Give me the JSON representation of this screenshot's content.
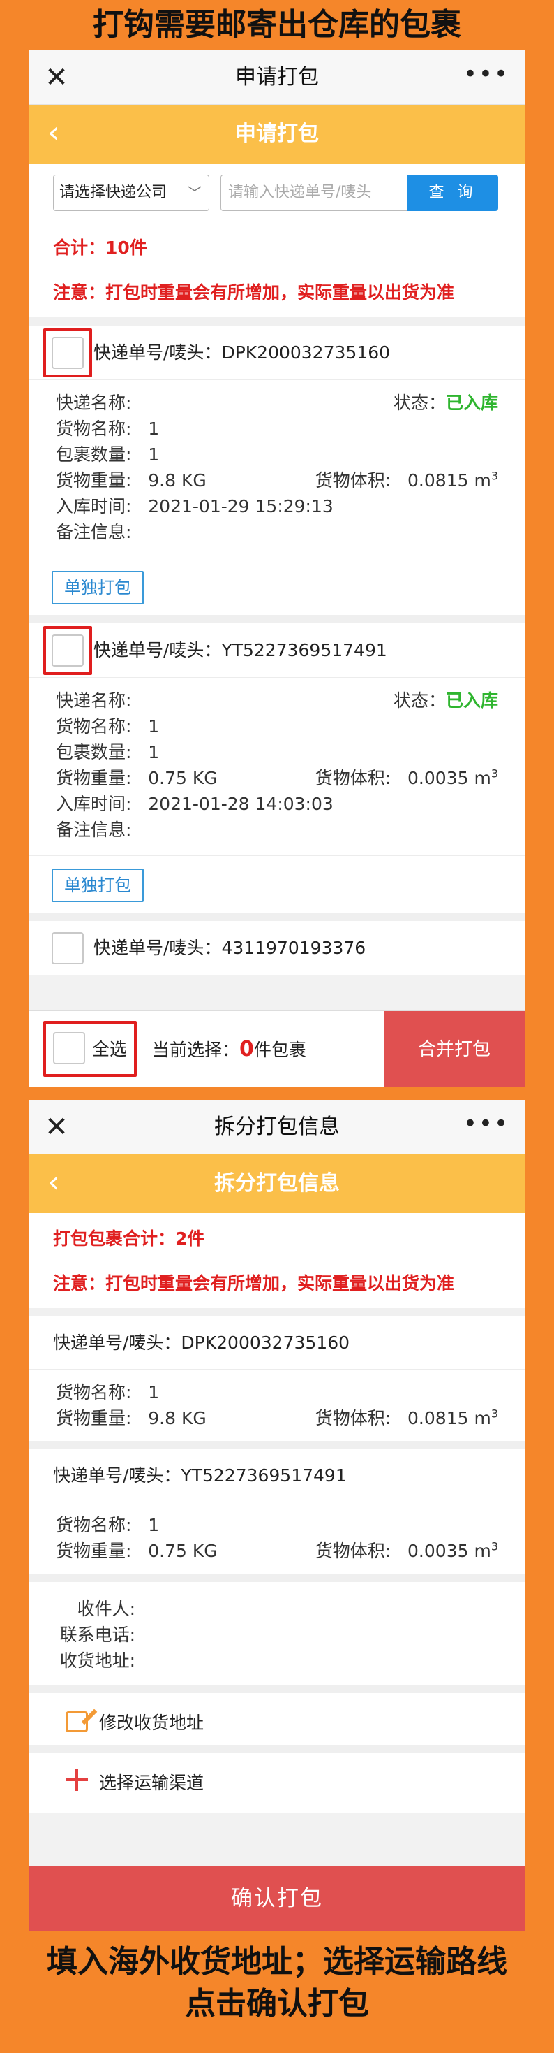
{
  "captions": {
    "top": "打钩需要邮寄出仓库的包裹",
    "bottom_line1": "填入海外收货地址；选择运输路线",
    "bottom_line2": "点击确认打包"
  },
  "screen1": {
    "wx_title": "申请打包",
    "header_title": "申请打包",
    "courier_select": "请选择快递公司",
    "tracking_placeholder": "请输入快递单号/唛头",
    "query_button": "查 询",
    "total": "合计：10件",
    "notice": "注意：打包时重量会有所增加，实际重量以出货为准",
    "labels": {
      "tracking": "快递单号/唛头：",
      "courier_name": "快递名称:",
      "status": "状态：",
      "goods_name": "货物名称:",
      "package_count": "包裹数量:",
      "goods_weight": "货物重量:",
      "goods_volume": "货物体积:",
      "inbound_time": "入库时间:",
      "remarks": "备注信息:"
    },
    "packages": [
      {
        "tracking_no": "DPK200032735160",
        "status": "已入库",
        "goods_name": "1",
        "package_count": "1",
        "weight": "9.8 KG",
        "volume": "0.0815 m",
        "volume_unit_exp": "3",
        "inbound_time": "2021-01-29 15:29:13",
        "single_pack_button": "单独打包"
      },
      {
        "tracking_no": "YT5227369517491",
        "status": "已入库",
        "goods_name": "1",
        "package_count": "1",
        "weight": "0.75 KG",
        "volume": "0.0035 m",
        "volume_unit_exp": "3",
        "inbound_time": "2021-01-28 14:03:03",
        "single_pack_button": "单独打包"
      },
      {
        "tracking_no": "4311970193376"
      }
    ],
    "select_all": "全选",
    "current_selection_prefix": "当前选择：",
    "current_selection_count": "0",
    "current_selection_suffix": "件包裹",
    "merge_button": "合并打包"
  },
  "screen2": {
    "wx_title": "拆分打包信息",
    "header_title": "拆分打包信息",
    "total": "打包包裹合计：2件",
    "notice": "注意：打包时重量会有所增加，实际重量以出货为准",
    "items": [
      {
        "tracking": "快递单号/唛头：DPK200032735160",
        "goods_name": "1",
        "weight": "9.8 KG",
        "volume": "0.0815 m",
        "volume_unit_exp": "3"
      },
      {
        "tracking": "快递单号/唛头：YT5227369517491",
        "goods_name": "1",
        "weight": "0.75 KG",
        "volume": "0.0035 m",
        "volume_unit_exp": "3"
      }
    ],
    "labels": {
      "goods_name": "货物名称:",
      "goods_weight": "货物重量:",
      "goods_volume": "货物体积:",
      "recipient": "收件人:",
      "phone": "联系电话:",
      "address": "收货地址:"
    },
    "edit_address": "修改收货地址",
    "select_channel": "选择运输渠道",
    "confirm_button": "确认打包"
  },
  "colors": {
    "page_bg": "#f5862a",
    "header_orange": "#fbbf49",
    "danger_red": "#e05050",
    "status_green": "#2fb52f",
    "query_blue": "#1e8fe4",
    "highlight_frame": "#e01e1e"
  },
  "icons": {
    "close": "close-icon",
    "more": "more-icon",
    "back": "back-chevron-icon",
    "dropdown": "chevron-down-icon",
    "edit": "edit-icon",
    "plus": "plus-icon"
  }
}
